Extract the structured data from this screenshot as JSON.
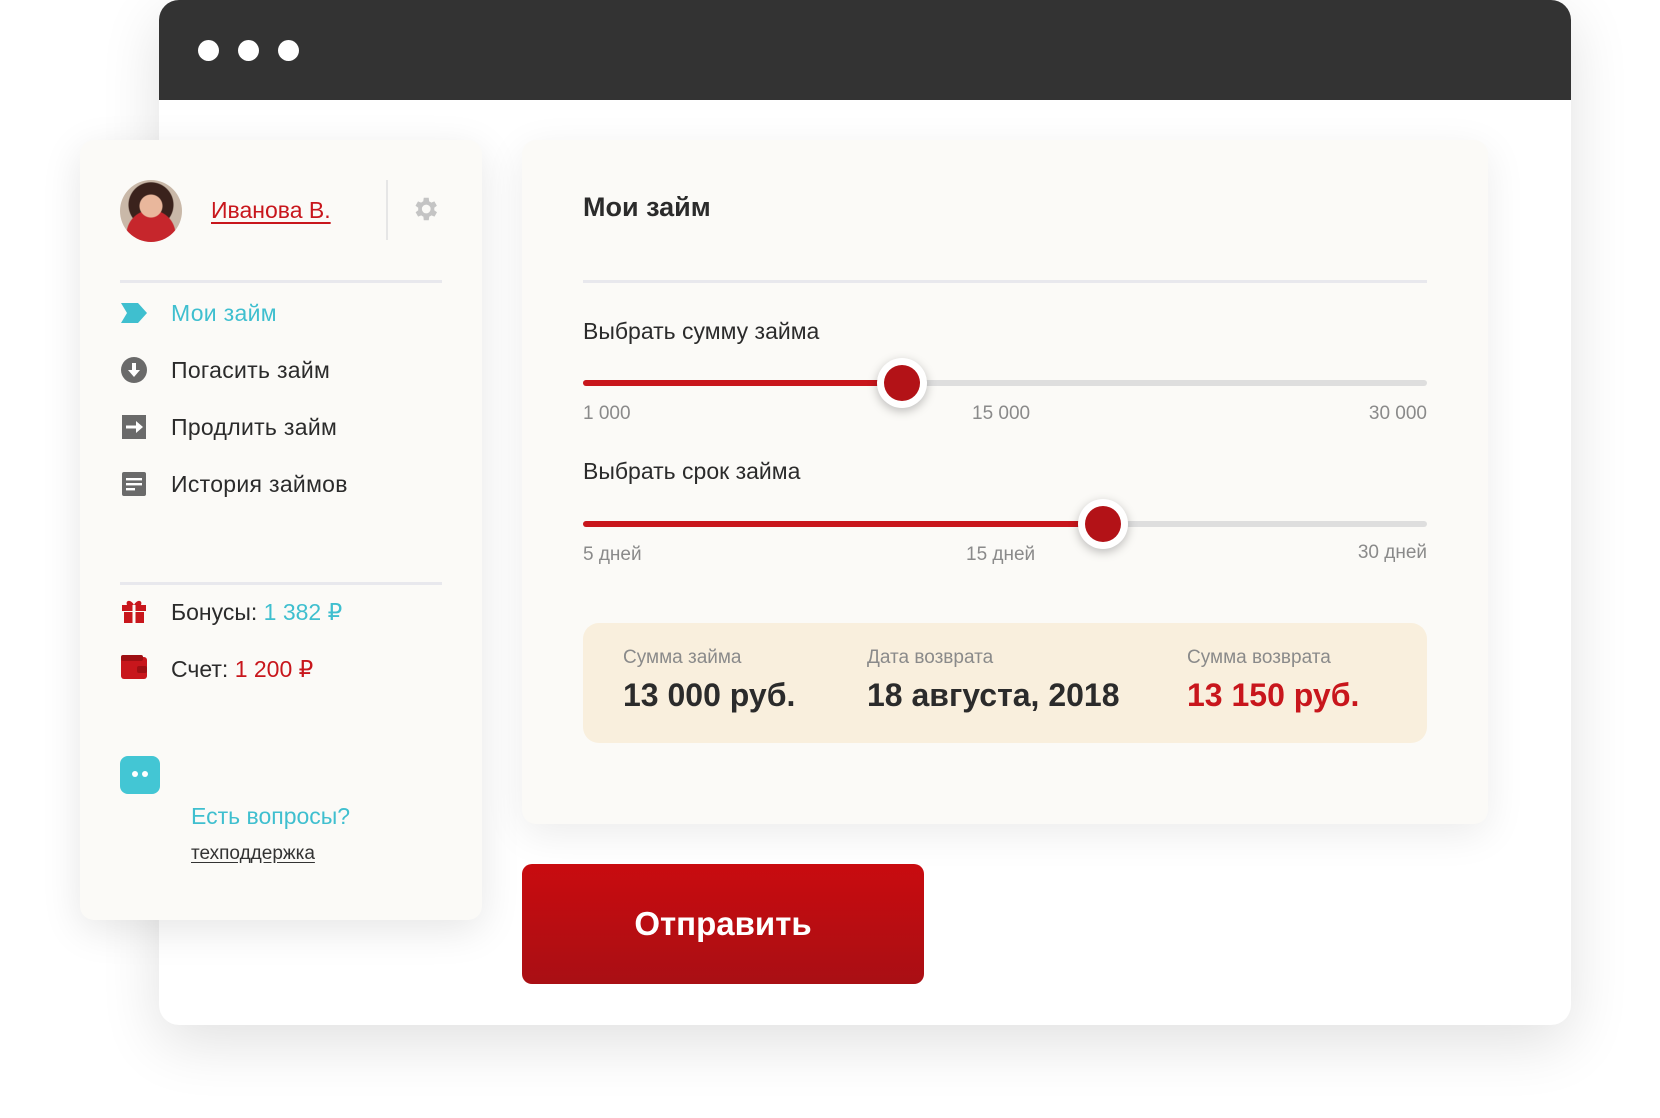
{
  "user": {
    "name": "Иванова В."
  },
  "sidebar": {
    "items": [
      {
        "label": "Мои займ",
        "icon": "arrow-tag-icon",
        "active": true
      },
      {
        "label": "Погасить займ",
        "icon": "download-circle-icon",
        "active": false
      },
      {
        "label": "Продлить займ",
        "icon": "arrow-box-icon",
        "active": false
      },
      {
        "label": "История займов",
        "icon": "list-icon",
        "active": false
      }
    ],
    "bonuses": {
      "label": "Бонусы:",
      "value": "1 382 ₽"
    },
    "account": {
      "label": "Счет:",
      "value": "1 200 ₽"
    },
    "help": {
      "question": "Есть вопросы?",
      "link": "техподдержка"
    }
  },
  "main": {
    "title": "Мои займ",
    "amount_slider": {
      "label": "Выбрать сумму займа",
      "min_label": "1 000",
      "mid_label": "15 000",
      "max_label": "30 000",
      "position_fraction": 0.378
    },
    "term_slider": {
      "label": "Выбрать срок займа",
      "min_label": "5 дней",
      "mid_label": "15 дней",
      "max_label": "30 дней",
      "position_fraction": 0.616
    },
    "summary": {
      "amount_caption": "Сумма займа",
      "amount_value": "13 000 руб.",
      "date_caption": "Дата возврата",
      "date_value": "18 августа, 2018",
      "return_caption": "Сумма возврата",
      "return_value": "13 150 руб."
    }
  },
  "submit_label": "Отправить",
  "colors": {
    "accent_red": "#c8161c",
    "accent_teal": "#3fbfcf",
    "titlebar": "#333333",
    "summary_bg": "#f9efdd"
  }
}
